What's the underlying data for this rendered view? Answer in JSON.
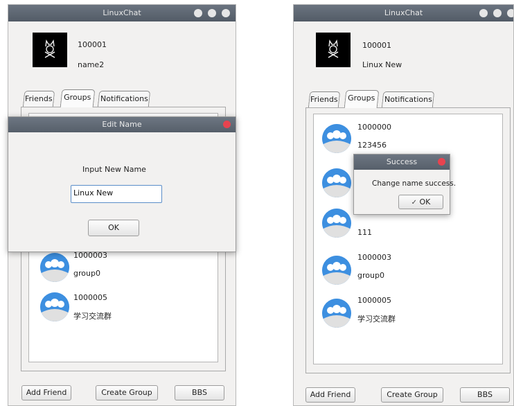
{
  "app_title": "LinuxChat",
  "left": {
    "user_id": "100001",
    "user_name": "name2",
    "tabs": [
      "Friends",
      "Groups",
      "Notifications"
    ],
    "items": [
      {
        "id": "1000003",
        "name": "group0"
      },
      {
        "id": "1000005",
        "name": "学习交流群"
      }
    ],
    "buttons": {
      "add_friend": "Add Friend",
      "create_group": "Create Group",
      "bbs": "BBS"
    },
    "edit_dialog": {
      "title": "Edit Name",
      "prompt": "Input New Name",
      "input_value": "Linux New",
      "ok": "OK"
    }
  },
  "right": {
    "user_id": "100001",
    "user_name": "Linux New",
    "tabs": [
      "Friends",
      "Groups",
      "Notifications"
    ],
    "items": [
      {
        "id": "1000000",
        "name": "123456"
      },
      {
        "id": "",
        "name": "111"
      },
      {
        "id": "1000003",
        "name": "group0"
      },
      {
        "id": "1000005",
        "name": "学习交流群"
      }
    ],
    "buttons": {
      "add_friend": "Add Friend",
      "create_group": "Create Group",
      "bbs": "BBS"
    },
    "success_dialog": {
      "title": "Success",
      "message": "Change name success.",
      "ok": "OK",
      "ok_icon": "✓"
    }
  },
  "colors": {
    "titlebar": "#5e6772",
    "close_red": "#e8434f",
    "avatar_blue": "#3d8fe0"
  }
}
